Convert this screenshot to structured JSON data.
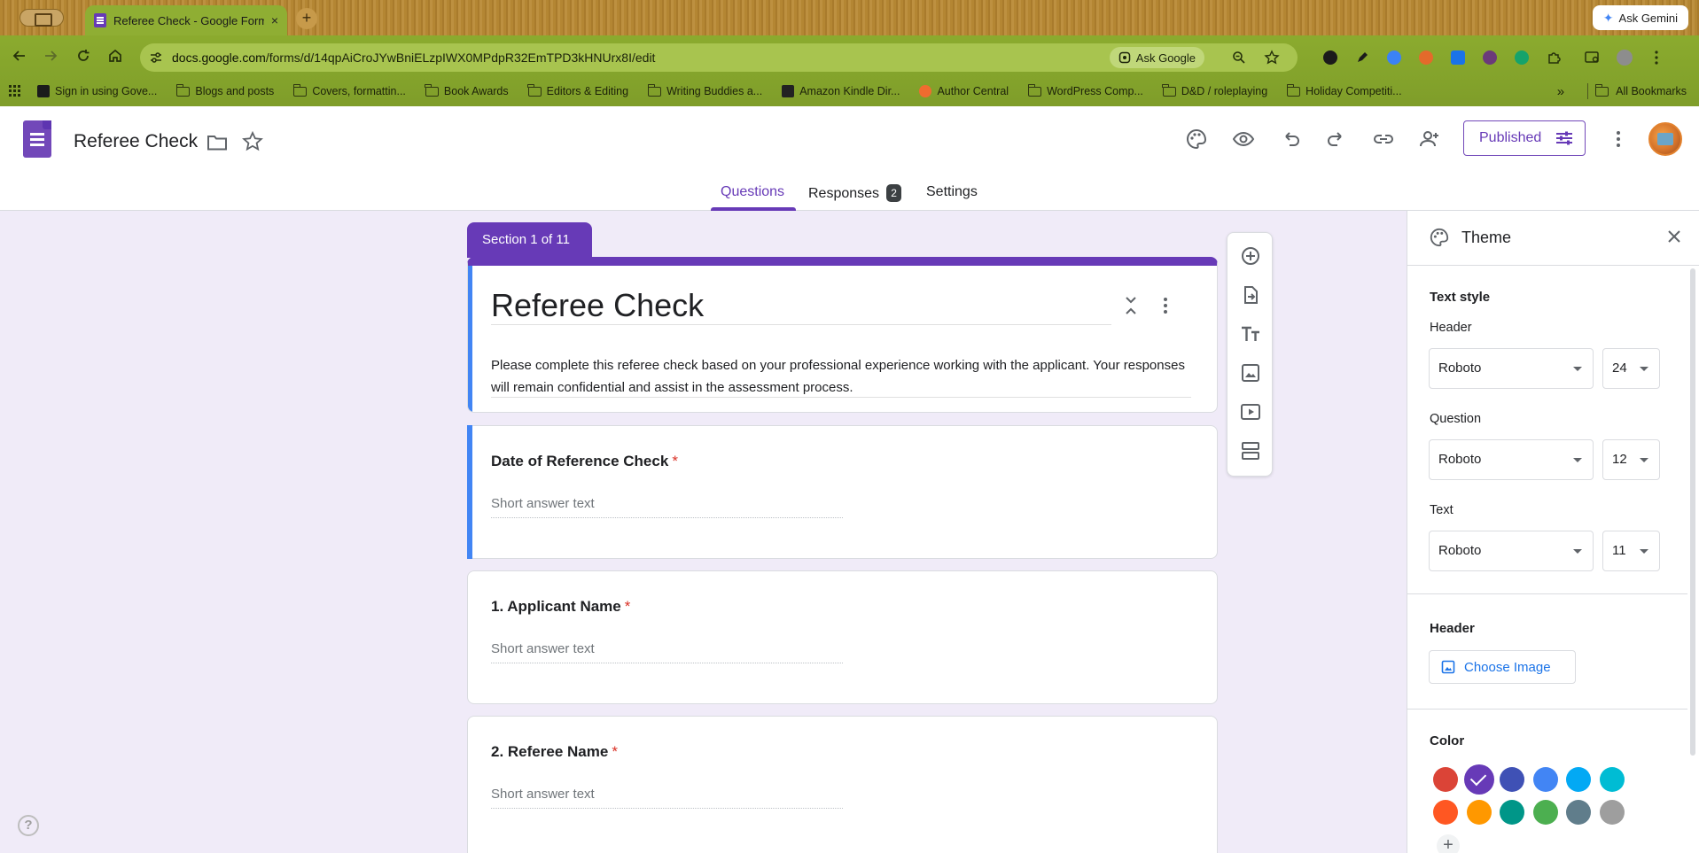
{
  "browser": {
    "tab_title": "Referee Check - Google Forms",
    "tab_close": "×",
    "new_tab": "+",
    "ask_gemini": "Ask Gemini",
    "url_host": "docs.google.com",
    "url_path": "/forms/d/14qpAiCroJYwBniELzpIWX0MPdpR32EmTPD3kHNUrx8I/edit",
    "ask_google": "Ask Google",
    "bookmarks": [
      "Sign in using Gove...",
      "Blogs and posts",
      "Covers, formattin...",
      "Book Awards",
      "Editors & Editing",
      "Writing Buddies a...",
      "Amazon Kindle Dir...",
      "Author Central",
      "WordPress Comp...",
      "D&D / roleplaying",
      "Holiday Competiti..."
    ],
    "bookmarks_more": "»",
    "all_bookmarks": "All Bookmarks"
  },
  "header": {
    "doc_title": "Referee Check",
    "published_label": "Published",
    "tabs": {
      "questions": "Questions",
      "responses": "Responses",
      "responses_count": "2",
      "settings": "Settings"
    }
  },
  "form": {
    "section_label": "Section 1 of 11",
    "title": "Referee Check",
    "description": "Please complete this referee check based on your professional experience working with the applicant. Your responses will remain confidential and assist in the assessment process.",
    "questions": [
      {
        "title": "Date of Reference Check",
        "required": "*",
        "placeholder": "Short answer text"
      },
      {
        "title": "1. Applicant Name",
        "required": "*",
        "placeholder": "Short answer text"
      },
      {
        "title": "2. Referee Name",
        "required": "*",
        "placeholder": "Short answer text"
      }
    ]
  },
  "help": "?",
  "theme": {
    "title": "Theme",
    "text_style_label": "Text style",
    "header_label": "Header",
    "header_font": "Roboto",
    "header_size": "24",
    "question_label": "Question",
    "question_font": "Roboto",
    "question_size": "12",
    "text_label": "Text",
    "text_font": "Roboto",
    "text_size": "11",
    "header_image_label": "Header",
    "choose_image": "Choose Image",
    "color_label": "Color",
    "add_color": "+",
    "colors": [
      "#db4437",
      "#673ab7",
      "#3f51b5",
      "#4285f4",
      "#03a9f4",
      "#00bcd4",
      "#ff5722",
      "#ff9800",
      "#009688",
      "#4caf50",
      "#607d8b",
      "#9e9e9e"
    ],
    "selected_color": "#673ab7"
  }
}
